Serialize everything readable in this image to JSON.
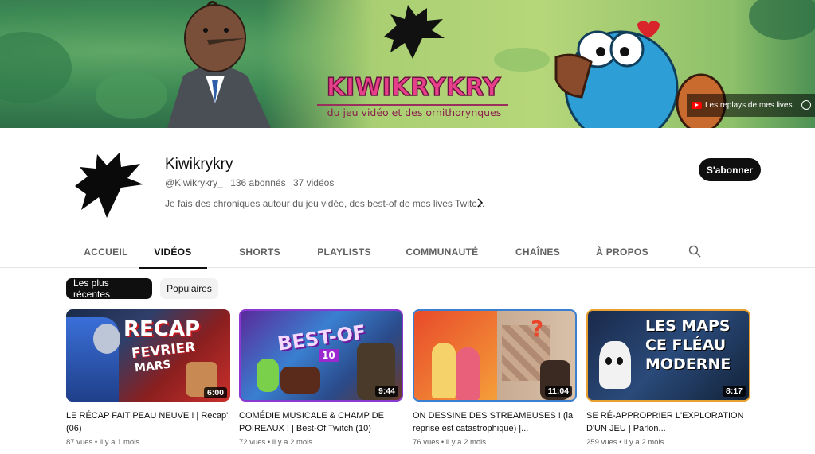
{
  "banner": {
    "title": "KIWIKRYKRY",
    "subtitle": "du jeu vidéo et des ornithorynques",
    "live_link_label": "Les replays de mes lives"
  },
  "channel": {
    "name": "Kiwikrykry",
    "handle": "@Kiwikrykry_",
    "subscribers": "136 abonnés",
    "video_count": "37 vidéos",
    "description": "Je fais des chroniques autour du jeu vidéo, des best-of de mes lives Twitc...",
    "subscribe_label": "S'abonner"
  },
  "tabs": [
    {
      "label": "ACCUEIL"
    },
    {
      "label": "VIDÉOS"
    },
    {
      "label": "SHORTS"
    },
    {
      "label": "PLAYLISTS"
    },
    {
      "label": "COMMUNAUTÉ"
    },
    {
      "label": "CHAÎNES"
    },
    {
      "label": "À PROPOS"
    }
  ],
  "active_tab": "VIDÉOS",
  "chips": [
    {
      "label": "Les plus récentes",
      "selected": true
    },
    {
      "label": "Populaires",
      "selected": false
    }
  ],
  "videos": [
    {
      "thumb_lines": [
        "RECAP",
        "FEVRIER",
        "MARS"
      ],
      "duration": "6:00",
      "title": "LE RÉCAP FAIT PEAU NEUVE ! | Recap' (06)",
      "views": "87 vues",
      "age": "il y a 1 mois"
    },
    {
      "thumb_lines": [
        "BEST-OF",
        "10"
      ],
      "duration": "9:44",
      "title": "COMÉDIE MUSICALE & CHAMP DE POIREAUX ! | Best-Of Twitch (10)",
      "views": "72 vues",
      "age": "il y a 2 mois"
    },
    {
      "thumb_lines": [
        "?"
      ],
      "duration": "11:04",
      "title": "ON DESSINE DES STREAMEUSES ! (la reprise est catastrophique) |...",
      "views": "76 vues",
      "age": "il y a 2 mois"
    },
    {
      "thumb_lines": [
        "LES MAPS",
        "CE FLÉAU",
        "MODERNE"
      ],
      "duration": "8:17",
      "title": "SE RÉ-APPROPRIER L'EXPLORATION D'UN JEU | Parlon...",
      "views": "259 vues",
      "age": "il y a 2 mois"
    }
  ],
  "colors": {
    "accent": "#0f0f0f",
    "banner_title": "#e83f8b",
    "secondary_text": "#606060"
  }
}
